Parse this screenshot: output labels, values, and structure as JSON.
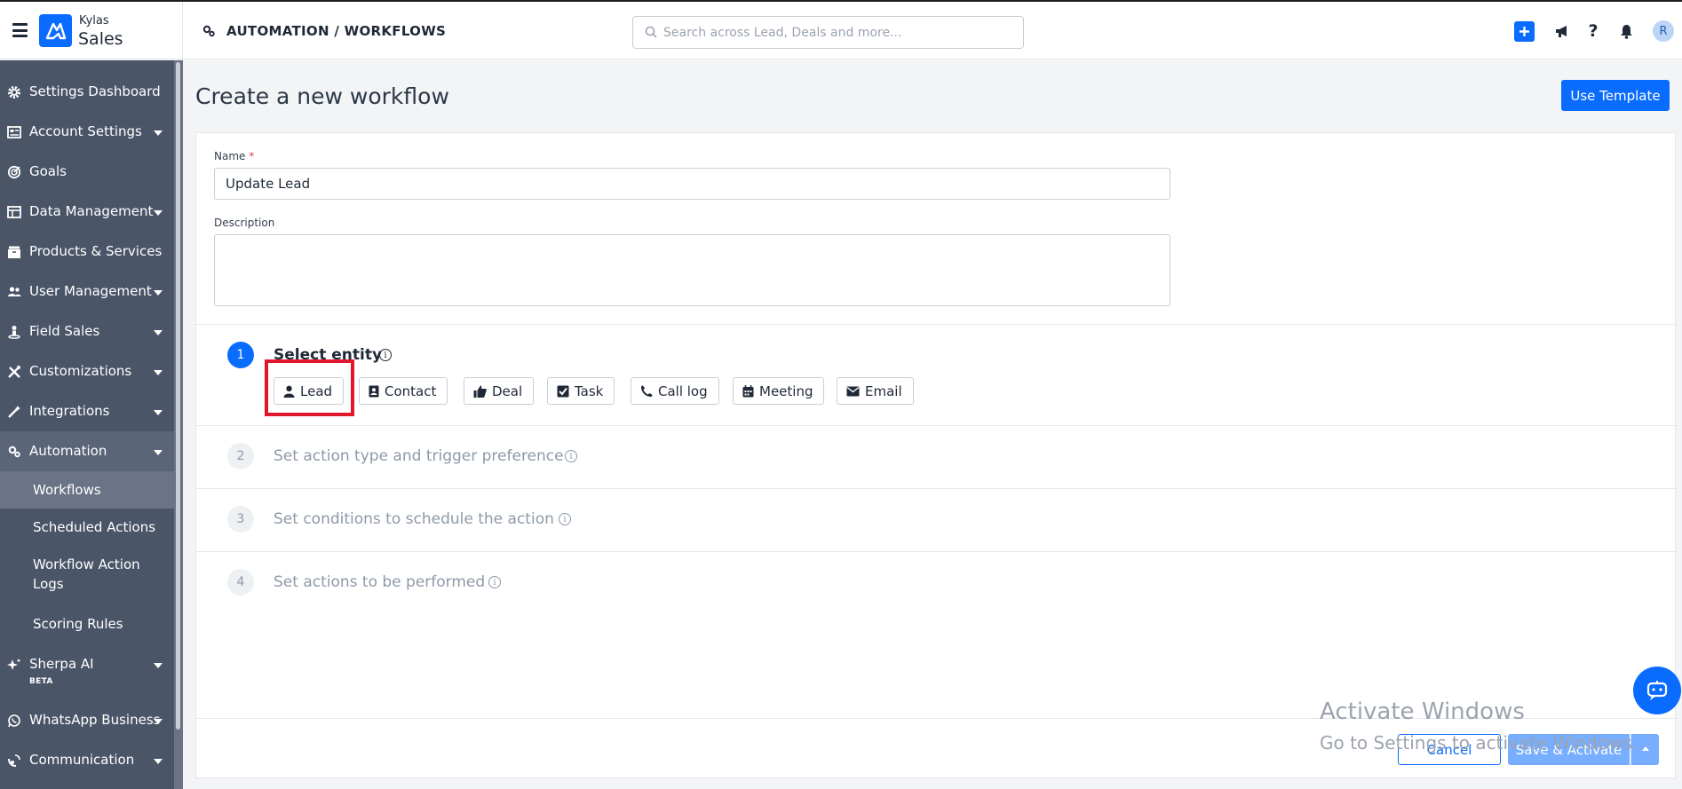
{
  "header": {
    "brand_top": "Kylas",
    "brand_bottom": "Sales",
    "breadcrumb": "AUTOMATION / WORKFLOWS",
    "search_placeholder": "Search across Lead, Deals and more...",
    "avatar_initial": "R",
    "icons": [
      "menu-icon",
      "plus-icon",
      "megaphone-icon",
      "help-icon",
      "bell-icon"
    ]
  },
  "sidebar": {
    "items": [
      {
        "label": "Settings Dashboard",
        "icon": "gear-icon"
      },
      {
        "label": "Account Settings",
        "icon": "account-icon"
      },
      {
        "label": "Goals",
        "icon": "target-icon"
      },
      {
        "label": "Data Management",
        "icon": "table-icon"
      },
      {
        "label": "Products & Services",
        "icon": "box-icon"
      },
      {
        "label": "User Management",
        "icon": "users-icon"
      },
      {
        "label": "Field Sales",
        "icon": "person-pin-icon"
      },
      {
        "label": "Customizations",
        "icon": "tools-icon"
      },
      {
        "label": "Integrations",
        "icon": "wand-icon"
      },
      {
        "label": "Automation",
        "icon": "gears-icon"
      }
    ],
    "sub_items": [
      "Workflows",
      "Scheduled Actions",
      "Workflow Action Logs",
      "Scoring Rules"
    ],
    "items_after": [
      {
        "label": "Sherpa AI",
        "icon": "sparkle-icon",
        "badge": "BETA"
      },
      {
        "label": "WhatsApp Business",
        "icon": "whatsapp-icon"
      },
      {
        "label": "Communication",
        "icon": "satellite-icon"
      }
    ]
  },
  "main": {
    "title": "Create a new workflow",
    "use_template": "Use Template",
    "name_label": "Name",
    "name_required_mark": "*",
    "name_value": "Update Lead",
    "description_label": "Description",
    "description_value": "",
    "steps": [
      {
        "number": "1",
        "title": "Select entity"
      },
      {
        "number": "2",
        "title": "Set action type and trigger preference"
      },
      {
        "number": "3",
        "title": "Set conditions to schedule the action"
      },
      {
        "number": "4",
        "title": "Set actions to be performed"
      }
    ],
    "info_glyph": "i",
    "entities": [
      {
        "label": "Lead",
        "icon": "user-icon"
      },
      {
        "label": "Contact",
        "icon": "contact-card-icon"
      },
      {
        "label": "Deal",
        "icon": "thumbs-up-icon"
      },
      {
        "label": "Task",
        "icon": "checkbox-icon"
      },
      {
        "label": "Call log",
        "icon": "phone-icon"
      },
      {
        "label": "Meeting",
        "icon": "calendar-icon"
      },
      {
        "label": "Email",
        "icon": "envelope-icon"
      }
    ]
  },
  "footer": {
    "cancel": "Cancel",
    "save_activate": "Save & Activate"
  },
  "watermark": {
    "line1": "Activate Windows",
    "line2": "Go to Settings to activate Windows."
  },
  "colors": {
    "primary": "#0a6cff",
    "sidebar_bg": "#4b5568",
    "highlight": "#e0182d"
  }
}
